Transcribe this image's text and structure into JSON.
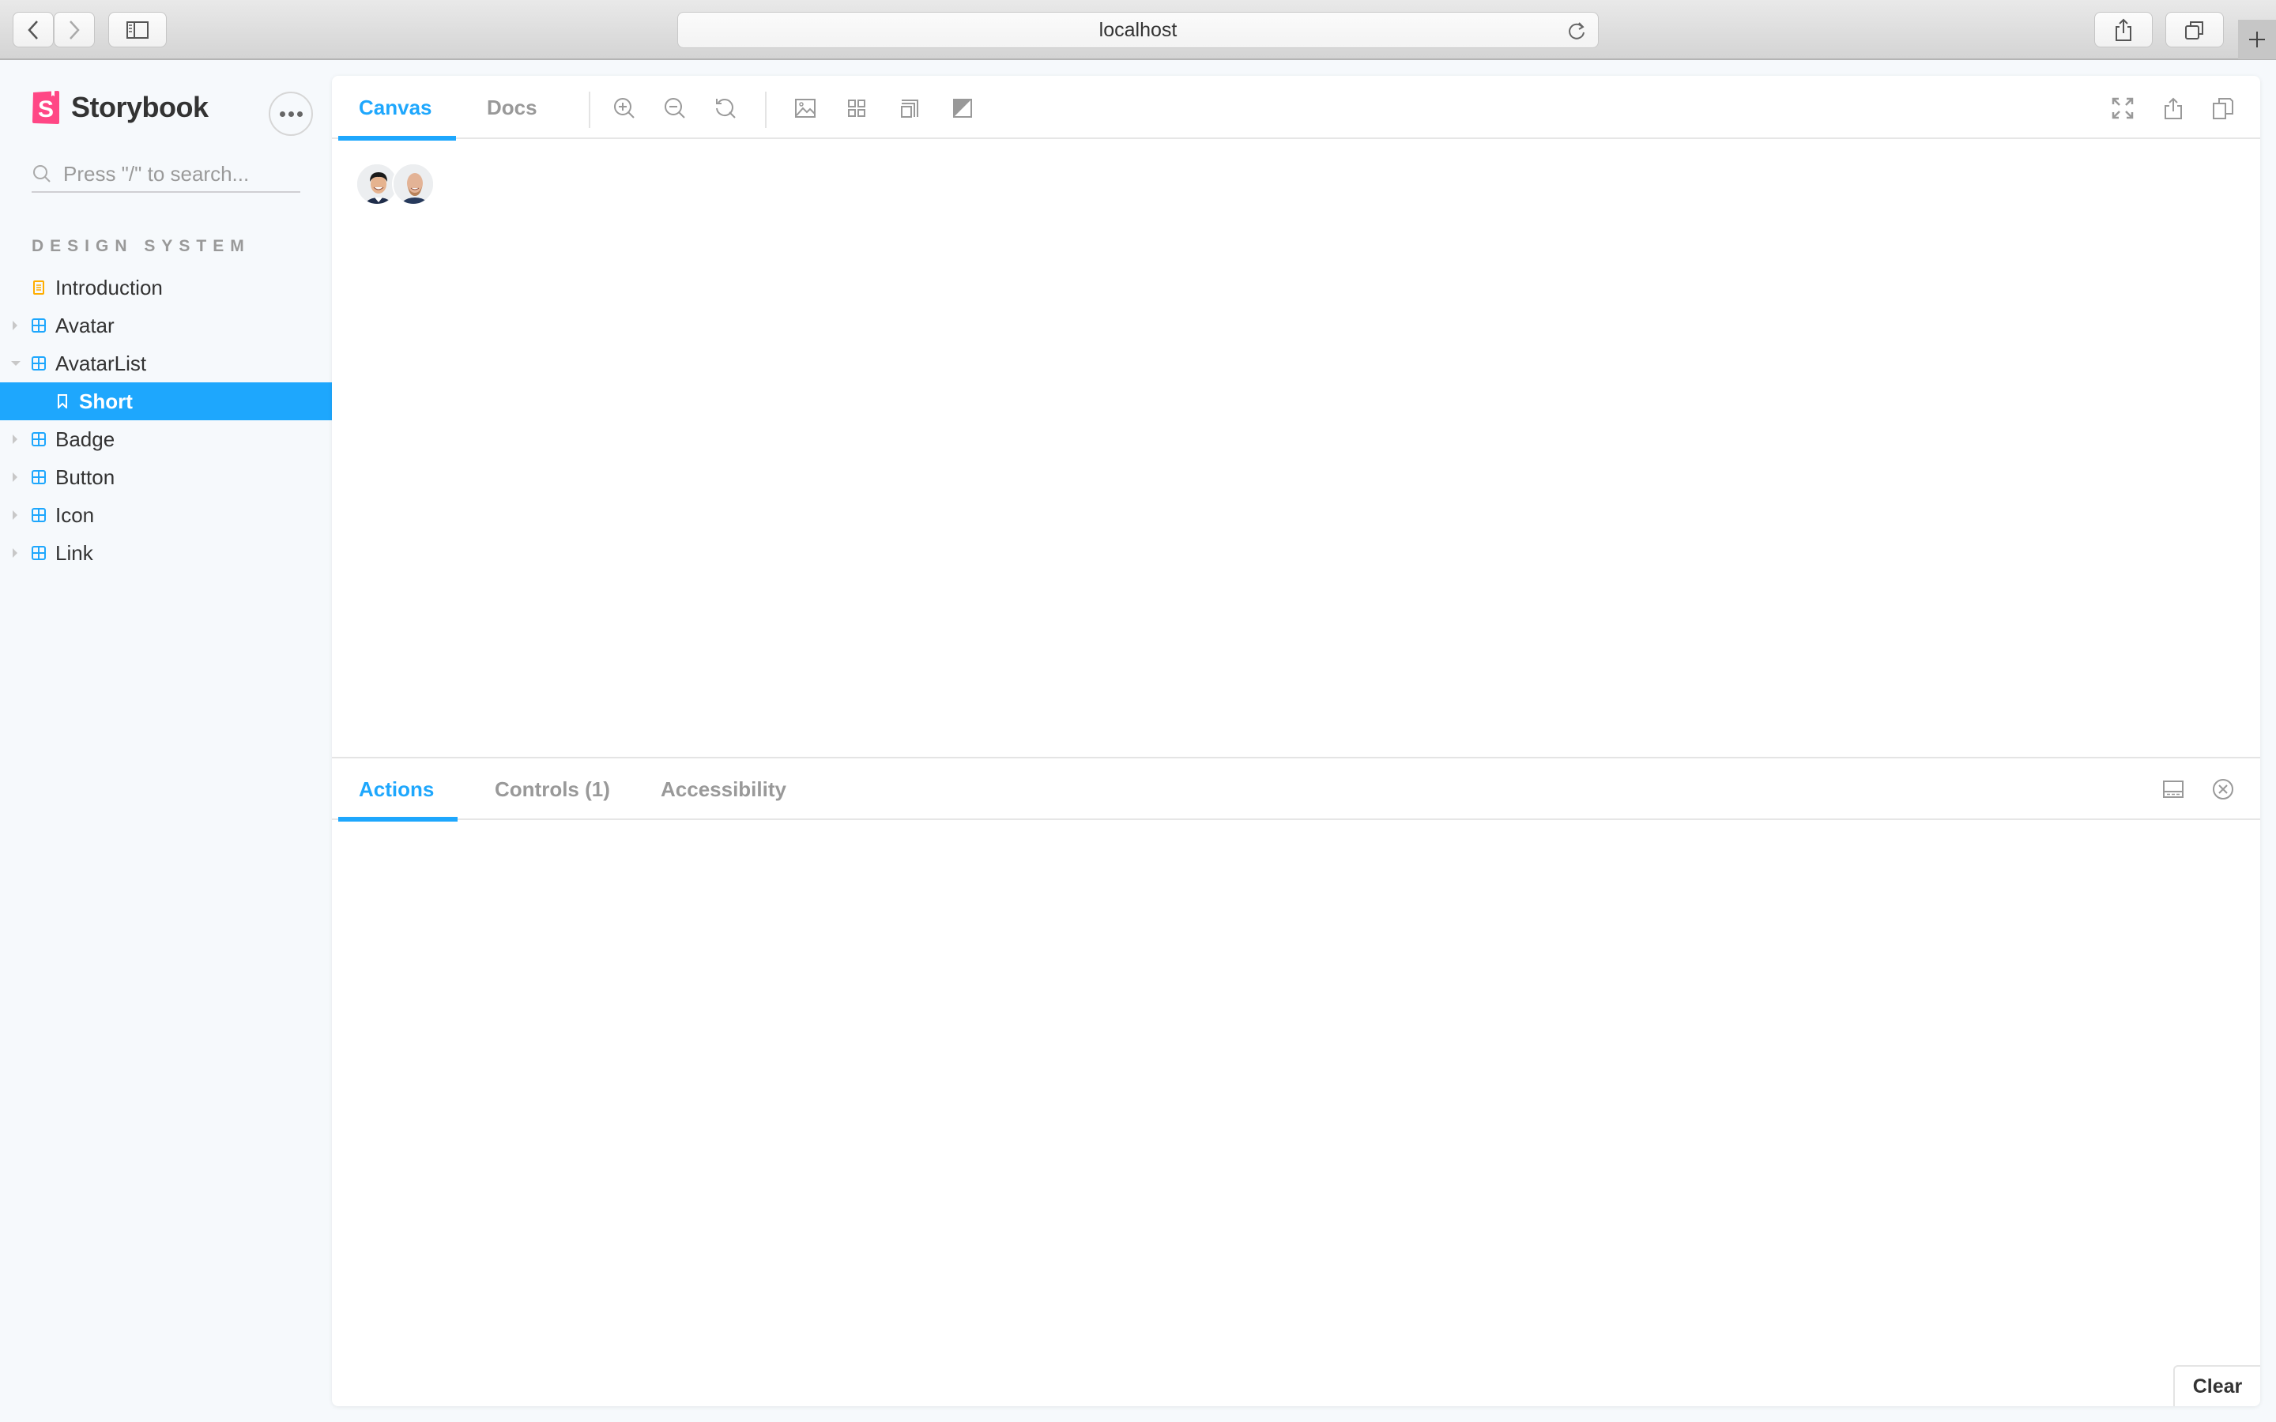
{
  "browser": {
    "url": "localhost",
    "buttons": [
      "back",
      "forward",
      "sidebar-toggle",
      "share",
      "tabs-overview",
      "new-tab"
    ]
  },
  "sidebar": {
    "brand": "Storybook",
    "search_placeholder": "Press \"/\" to search...",
    "section_title": "DESIGN SYSTEM",
    "items": [
      {
        "label": "Introduction",
        "type": "docs",
        "expandable": false
      },
      {
        "label": "Avatar",
        "type": "component",
        "expandable": true,
        "expanded": false
      },
      {
        "label": "AvatarList",
        "type": "component",
        "expandable": true,
        "expanded": true
      },
      {
        "label": "Short",
        "type": "story",
        "selected": true
      },
      {
        "label": "Badge",
        "type": "component",
        "expandable": true,
        "expanded": false
      },
      {
        "label": "Button",
        "type": "component",
        "expandable": true,
        "expanded": false
      },
      {
        "label": "Icon",
        "type": "component",
        "expandable": true,
        "expanded": false
      },
      {
        "label": "Link",
        "type": "component",
        "expandable": true,
        "expanded": false
      }
    ]
  },
  "toolbar": {
    "tabs": [
      {
        "label": "Canvas",
        "active": true
      },
      {
        "label": "Docs",
        "active": false
      }
    ],
    "tools": [
      "zoom-in-icon",
      "zoom-out-icon",
      "zoom-reset-icon",
      "background-icon",
      "grid-icon",
      "viewport-icon",
      "contrast-icon"
    ],
    "right_tools": [
      "fullscreen-icon",
      "share-icon",
      "copy-icon"
    ]
  },
  "canvas": {
    "avatars": [
      "avatar-1",
      "avatar-2"
    ]
  },
  "addons": {
    "tabs": [
      {
        "label": "Actions",
        "active": true
      },
      {
        "label": "Controls (1)",
        "active": false
      },
      {
        "label": "Accessibility",
        "active": false
      }
    ],
    "clear_label": "Clear"
  },
  "colors": {
    "accent": "#1ea7fd",
    "brand": "#ff4785",
    "docs_icon": "#ffae00"
  }
}
